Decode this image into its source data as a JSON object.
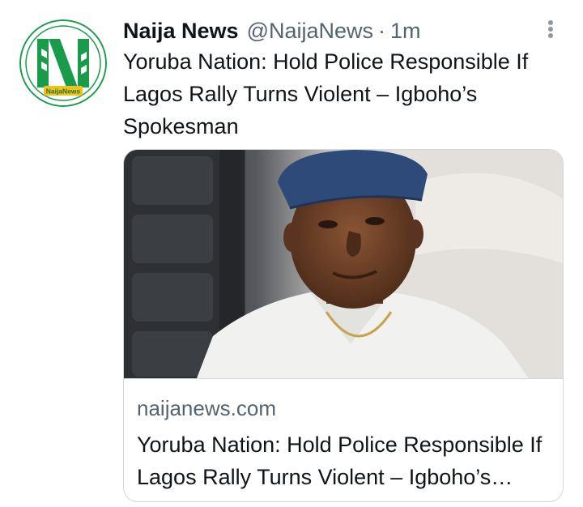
{
  "tweet": {
    "display_name": "Naija News",
    "handle": "@NaijaNews",
    "separator": "·",
    "time": "1m",
    "text": "Yoruba Nation: Hold Police Responsible If Lagos Rally Turns Violent – Igboho’s Spokesman",
    "avatar_label": "NaijaNews",
    "more_icon": "more-vertical-icon"
  },
  "card": {
    "domain": "naijanews.com",
    "title": "Yoruba Nation: Hold Police Responsible If Lagos Rally Turns Violent – Igboho’s Spokesman"
  },
  "colors": {
    "brand_green": "#1a9b4a",
    "text_primary": "#0f1419",
    "text_secondary": "#536471",
    "border": "#cfd9de"
  }
}
